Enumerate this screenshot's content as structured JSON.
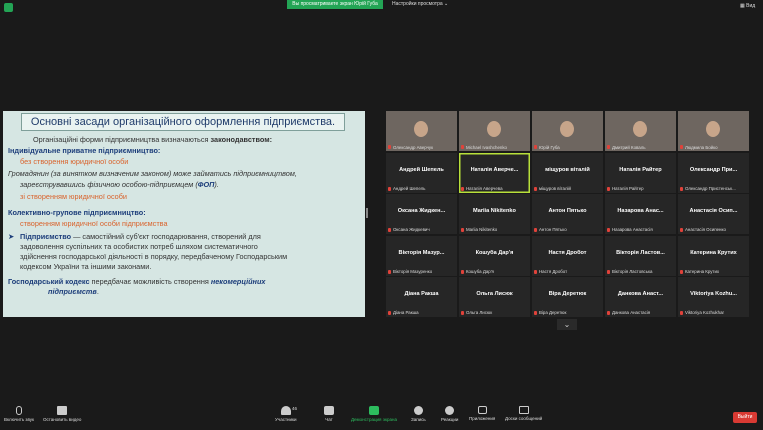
{
  "top": {
    "viewing": "Вы просматриваете экран Юрій Губа",
    "view_options": "Настройки просмотра",
    "view_button": "Вид"
  },
  "slide": {
    "title": "Основні засади організаційного оформлення підприємства.",
    "l1a": "Організаційні форми підприємництва визначаються ",
    "l1b": "законодавством:",
    "l2": "Індивідуальне приватне підприємництво:",
    "l3": "без створення юридичної особи",
    "l4": "Громадянин (за винятком визначеним законом) може займатись підприємництвом,",
    "l5a": "зареєструвавшись фізичною особою-підприємцем (",
    "l5b": "ФОП",
    "l5c": ").",
    "l6": "зі створенням юридичної особи",
    "l7": "Колективно-групове підприємництво:",
    "l8": "створенням юридичної особи підприємства",
    "l9a": "Підприємство",
    "l9b": " — самостійний суб'єкт господарювання, створений для",
    "l10": "задоволення суспільних та особистих потреб шляхом систематичного",
    "l11": "здійснення господарської діяльності в порядку, передбаченому Господарським",
    "l12": "кодексом України та іншими законами.",
    "l13a": "Господарський кодекс",
    "l13b": " передбачає можливість створення ",
    "l13c": "некомерційних",
    "l14": "підприємств",
    "l14b": "."
  },
  "participants": [
    {
      "name": "",
      "label": "Олександр Аверчук",
      "video": true
    },
    {
      "name": "",
      "label": "Michael Ivashchenko",
      "video": true
    },
    {
      "name": "",
      "label": "Юрій Губа",
      "video": true
    },
    {
      "name": "",
      "label": "Дмитрий Коваль",
      "video": true
    },
    {
      "name": "",
      "label": "Людмила Бойко",
      "video": true
    },
    {
      "name": "Андрей Шепель",
      "label": "Андрей Шепель"
    },
    {
      "name": "Наталія Аверче...",
      "label": "Наталія Аверчева"
    },
    {
      "name": "міщуров віталій",
      "label": "міщуров віталій"
    },
    {
      "name": "Наталія Райтер",
      "label": "Наталія Райтер"
    },
    {
      "name": "Олександр При...",
      "label": "Олександр Пристенськ..."
    },
    {
      "name": "Оксана Жидкен...",
      "label": "Оксана Жидкевич"
    },
    {
      "name": "Mariia Nikitenko",
      "label": "Mariia Nikitenko"
    },
    {
      "name": "Антон Пятько",
      "label": "Антон Пятько"
    },
    {
      "name": "Назарова Анас...",
      "label": "Назарова Анастасія"
    },
    {
      "name": "Анастасія Осип...",
      "label": "Анастасія Осипенко"
    },
    {
      "name": "Вікторія Мазур...",
      "label": "Вікторія Мазуренко"
    },
    {
      "name": "Кошуба Дар'я",
      "label": "Кошуба Дар'я"
    },
    {
      "name": "Настя Дробот",
      "label": "Настя Дробот"
    },
    {
      "name": "Вікторія Ластов...",
      "label": "Вікторія Ластовська"
    },
    {
      "name": "Катерина Крутих",
      "label": "Катерина Крутих"
    },
    {
      "name": "Діана Ракша",
      "label": "Діана Ракша"
    },
    {
      "name": "Ольга Лисюк",
      "label": "Ольга Лисюк"
    },
    {
      "name": "Віра Деретюк",
      "label": "Віра Деретюк"
    },
    {
      "name": "Данкова Анаст...",
      "label": "Данкова Анастасія"
    },
    {
      "name": "Viktoriya Kozhu...",
      "label": "Viktoriya Kozhukhar"
    }
  ],
  "toolbar": {
    "mic": "Включить звук",
    "video": "Остановить видео",
    "participants": "Участники",
    "participants_count": "46",
    "chat": "Чат",
    "share": "Демонстрация экрана",
    "record": "Запись",
    "reactions": "Реакции",
    "apps": "Приложения",
    "whiteboards": "Доски сообщений",
    "exit": "Выйти"
  }
}
